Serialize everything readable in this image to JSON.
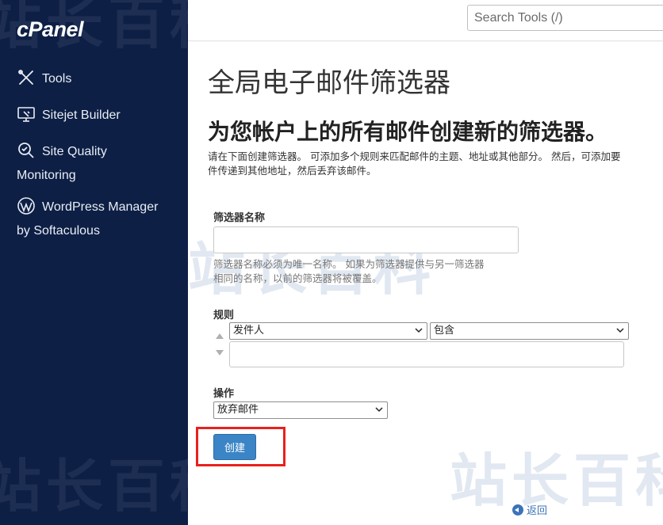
{
  "brand": {
    "logo_text": "cPanel"
  },
  "sidebar": {
    "items": [
      {
        "label": "Tools",
        "icon": "tools-icon"
      },
      {
        "label": "Sitejet Builder",
        "icon": "sitejet-icon"
      },
      {
        "label_line1": "Site Quality",
        "label_line2": "Monitoring",
        "icon": "site-quality-icon"
      },
      {
        "label_line1": "WordPress Manager",
        "label_line2": "by Softaculous",
        "icon": "wordpress-icon"
      }
    ]
  },
  "search": {
    "placeholder": "Search Tools (/)"
  },
  "page": {
    "title": "全局电子邮件筛选器",
    "subtitle": "为您帐户上的所有邮件创建新的筛选器。",
    "intro_line1": "请在下面创建筛选器。 可添加多个规则来匹配邮件的主题、地址或其他部分。 然后，可添加要",
    "intro_line2": "件传递到其他地址，然后丢弃该邮件。"
  },
  "form": {
    "filter_name_label": "筛选器名称",
    "filter_name_value": "",
    "filter_name_help_line1": "筛选器名称必须为唯一名称。 如果为筛选器提供与另一筛选器",
    "filter_name_help_line2": "相同的名称，以前的筛选器将被覆盖。",
    "rules_label": "规则",
    "rule_field_selected": "发件人",
    "rule_operator_selected": "包含",
    "rule_value": "",
    "actions_label": "操作",
    "action_selected": "放弃邮件",
    "create_button": "创建",
    "back_link": "返回"
  },
  "watermark": {
    "text": "站长百科"
  },
  "colors": {
    "sidebar_bg": "#0d1f45",
    "button_primary": "#3b85c6",
    "highlight_border": "#e8211d",
    "link": "#3b73b9"
  }
}
